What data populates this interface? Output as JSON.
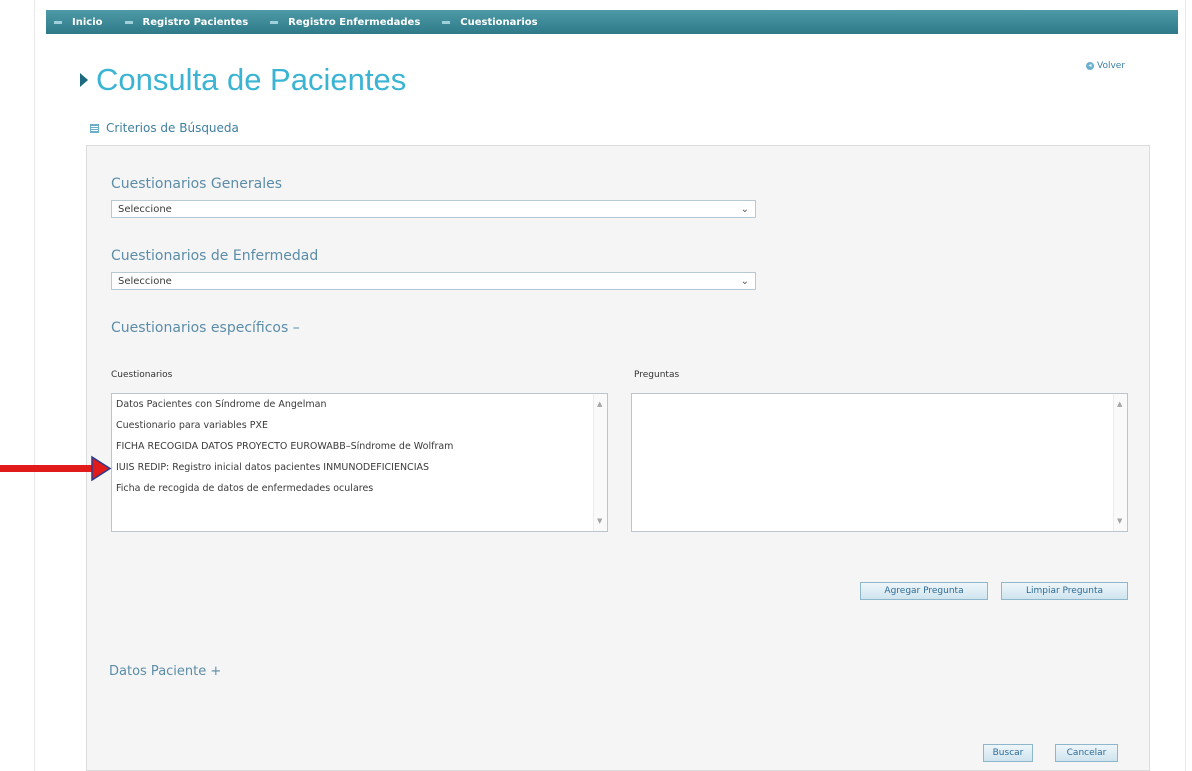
{
  "nav": {
    "items": [
      {
        "label": "Inicio"
      },
      {
        "label": "Registro Pacientes"
      },
      {
        "label": "Registro Enfermedades"
      },
      {
        "label": "Cuestionarios"
      }
    ]
  },
  "header": {
    "title": "Consulta de Pacientes",
    "back_label": "Volver"
  },
  "criteria": {
    "title": "Criterios de Búsqueda"
  },
  "form": {
    "general": {
      "label": "Cuestionarios Generales",
      "selected": "Seleccione"
    },
    "disease": {
      "label": "Cuestionarios de Enfermedad",
      "selected": "Seleccione"
    },
    "specific": {
      "label": "Cuestionarios específicos –",
      "questionnaires_label": "Cuestionarios",
      "questions_label": "Preguntas",
      "questionnaires": [
        "Datos Pacientes con Síndrome de Angelman",
        "Cuestionario para variables PXE",
        "FICHA RECOGIDA DATOS PROYECTO EUROWABB–Síndrome de Wolfram",
        "IUIS REDIP: Registro inicial datos pacientes INMUNODEFICIENCIAS",
        "Ficha de recogida de datos de enfermedades oculares"
      ],
      "questions": [],
      "add_button": "Agregar Pregunta",
      "clear_button": "Limpiar Pregunta"
    },
    "patient": {
      "label": "Datos Paciente +"
    },
    "search_button": "Buscar",
    "cancel_button": "Cancelar"
  },
  "annotation": {
    "arrow_color": "#e11a1a",
    "arrow_target": "IUIS REDIP: Registro inicial datos pacientes INMUNODEFICIENCIAS"
  }
}
